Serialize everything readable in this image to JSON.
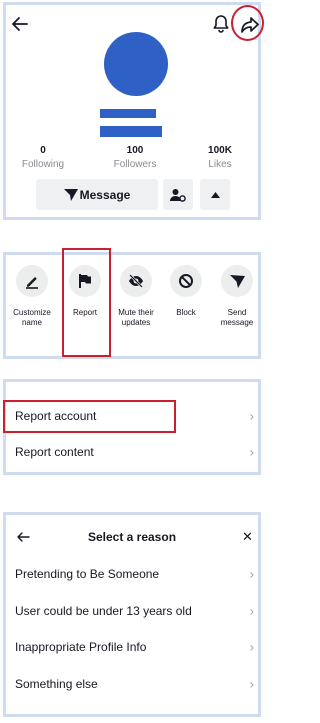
{
  "profile": {
    "stats": [
      {
        "value": "0",
        "label": "Following"
      },
      {
        "value": "100",
        "label": "Followers"
      },
      {
        "value": "100K",
        "label": "Likes"
      }
    ],
    "message_label": "Message"
  },
  "actions": [
    {
      "label": "Customize name",
      "icon": "pencil-icon"
    },
    {
      "label": "Report",
      "icon": "flag-icon"
    },
    {
      "label": "Mute their updates",
      "icon": "eye-off-icon"
    },
    {
      "label": "Block",
      "icon": "block-icon"
    },
    {
      "label": "Send message",
      "icon": "send-icon"
    }
  ],
  "report_menu": {
    "items": [
      {
        "label": "Report account"
      },
      {
        "label": "Report content"
      }
    ]
  },
  "reason_sheet": {
    "title": "Select a reason",
    "reasons": [
      {
        "label": "Pretending to Be Someone"
      },
      {
        "label": "User could be under 13 years old"
      },
      {
        "label": "Inappropriate Profile Info"
      },
      {
        "label": "Something else"
      }
    ]
  },
  "colors": {
    "avatar_placeholder": "#2e60c6",
    "highlight_annotation": "#c8202f",
    "panel_border": "#cfdcf0"
  }
}
